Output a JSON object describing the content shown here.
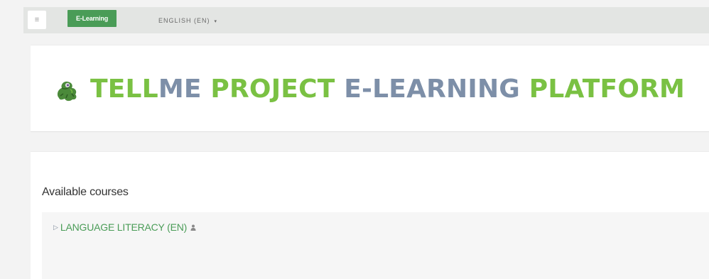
{
  "navbar": {
    "menu_icon": "hamburger-icon",
    "brand_label": "E-Learning",
    "language_label": "ENGLISH (EN)",
    "language_caret": "▾"
  },
  "header": {
    "logo_icon": "mascot-logo-icon",
    "title_part1": "TELL",
    "title_part2": "ME",
    "title_part3": "PROJECT",
    "title_part4": "E-LEARNING",
    "title_part5": "PLATFORM"
  },
  "main": {
    "section_title": "Available courses",
    "courses": [
      {
        "label": "LANGUAGE LITERACY (EN)",
        "arrow_icon": "course-arrow-icon",
        "badge_icon": "guest-access-icon"
      }
    ]
  },
  "colors": {
    "brand_green": "#4a9c57",
    "title_green": "#7ac143",
    "title_blue": "#7d8fa8",
    "link_green": "#4a9c57"
  }
}
